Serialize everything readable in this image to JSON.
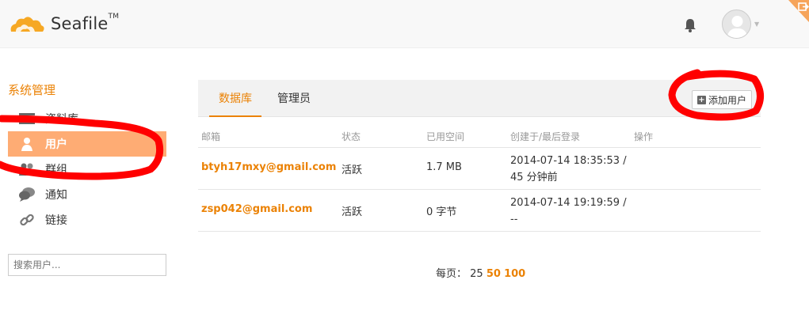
{
  "header": {
    "app_name": "Seafile",
    "trademark": "TM",
    "notification_icon": "bell-icon",
    "avatar_icon": "user-avatar-icon"
  },
  "sidebar": {
    "title": "系统管理",
    "items": [
      {
        "label": "资料库",
        "icon": "library-icon"
      },
      {
        "label": "用户",
        "icon": "user-icon"
      },
      {
        "label": "群组",
        "icon": "group-icon"
      },
      {
        "label": "通知",
        "icon": "notification-icon"
      },
      {
        "label": "链接",
        "icon": "link-icon"
      }
    ],
    "search_placeholder": "搜索用户..."
  },
  "main": {
    "tabs": [
      {
        "label": "数据库"
      },
      {
        "label": "管理员"
      }
    ],
    "add_user_label": "添加用户",
    "table": {
      "headers": [
        "邮箱",
        "状态",
        "已用空间",
        "创建于/最后登录",
        "操作"
      ],
      "rows": [
        {
          "email": "btyh17mxy@gmail.com",
          "status": "活跃",
          "space": "1.7 MB",
          "created": "2014-07-14 18:35:53 /",
          "last_login": "45 分钟前"
        },
        {
          "email": "zsp042@gmail.com",
          "status": "活跃",
          "space": "0 字节",
          "created": "2014-07-14 19:19:59 /",
          "last_login": "--"
        }
      ]
    },
    "pagination": {
      "label": "每页：",
      "current": "25",
      "options": [
        "50",
        "100"
      ]
    }
  },
  "colors": {
    "accent": "#eb8205",
    "active_nav": "#feac74",
    "annotation": "#ff0000"
  }
}
